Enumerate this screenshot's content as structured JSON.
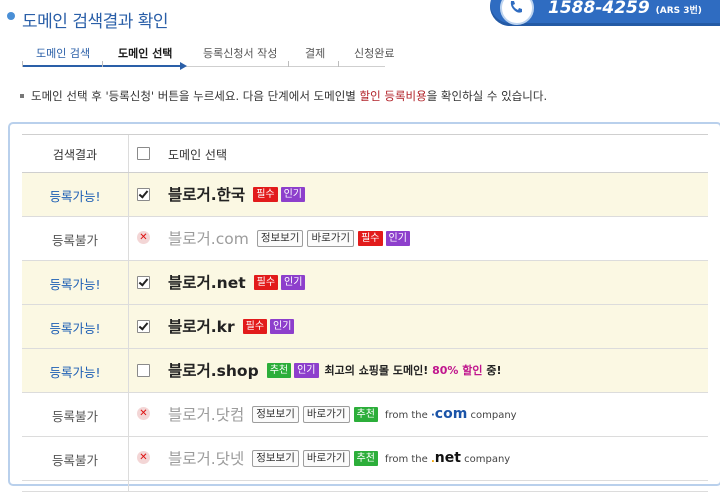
{
  "page": {
    "title": "도메인 검색결과 확인"
  },
  "contact": {
    "phone": "1588-4259",
    "phone_sub": "(ARS 3번)"
  },
  "steps": [
    {
      "label": "도메인 검색",
      "state": "done"
    },
    {
      "label": "도메인 선택",
      "state": "active"
    },
    {
      "label": "등록신청서 작성",
      "state": "todo"
    },
    {
      "label": "결제",
      "state": "todo"
    },
    {
      "label": "신청완료",
      "state": "todo"
    }
  ],
  "notice": {
    "part1": "도메인 선택 후 '등록신청' 버튼을 누르세요. 다음 단계에서 도메인별 ",
    "highlight": "할인 등록비용",
    "part2": "을 확인하실 수 있습니다."
  },
  "table": {
    "header": {
      "status": "검색결과",
      "select": "도메인 선택"
    },
    "labels": {
      "available": "등록가능!",
      "unavailable": "등록불가",
      "info": "정보보기",
      "go": "바로가기",
      "required": "필수",
      "popular": "인기",
      "recommended": "추천",
      "from": "from the",
      "company": "company"
    },
    "rows": [
      {
        "status": "등록가능!",
        "domain": "블로거.한국",
        "checked": true
      },
      {
        "status": "등록불가",
        "domain": "블로거.com"
      },
      {
        "status": "등록가능!",
        "domain": "블로거.net",
        "checked": true
      },
      {
        "status": "등록가능!",
        "domain": "블로거.kr",
        "checked": true
      },
      {
        "status": "등록가능!",
        "domain": "블로거.shop",
        "checked": false,
        "promo": "최고의 쇼핑몰 도메인!",
        "promo_pct": "80% 할인",
        "promo_tail": "중!"
      },
      {
        "status": "등록불가",
        "domain": "블로거.닷컴",
        "brand": "com"
      },
      {
        "status": "등록불가",
        "domain": "블로거.닷넷",
        "brand": "net"
      }
    ]
  },
  "colors": {
    "accent": "#2a5fa8",
    "available_row": "#fbf8e3",
    "required_tag": "#e21b1b",
    "popular_tag": "#8d3fcc",
    "recommended_tag": "#2cae3a"
  }
}
